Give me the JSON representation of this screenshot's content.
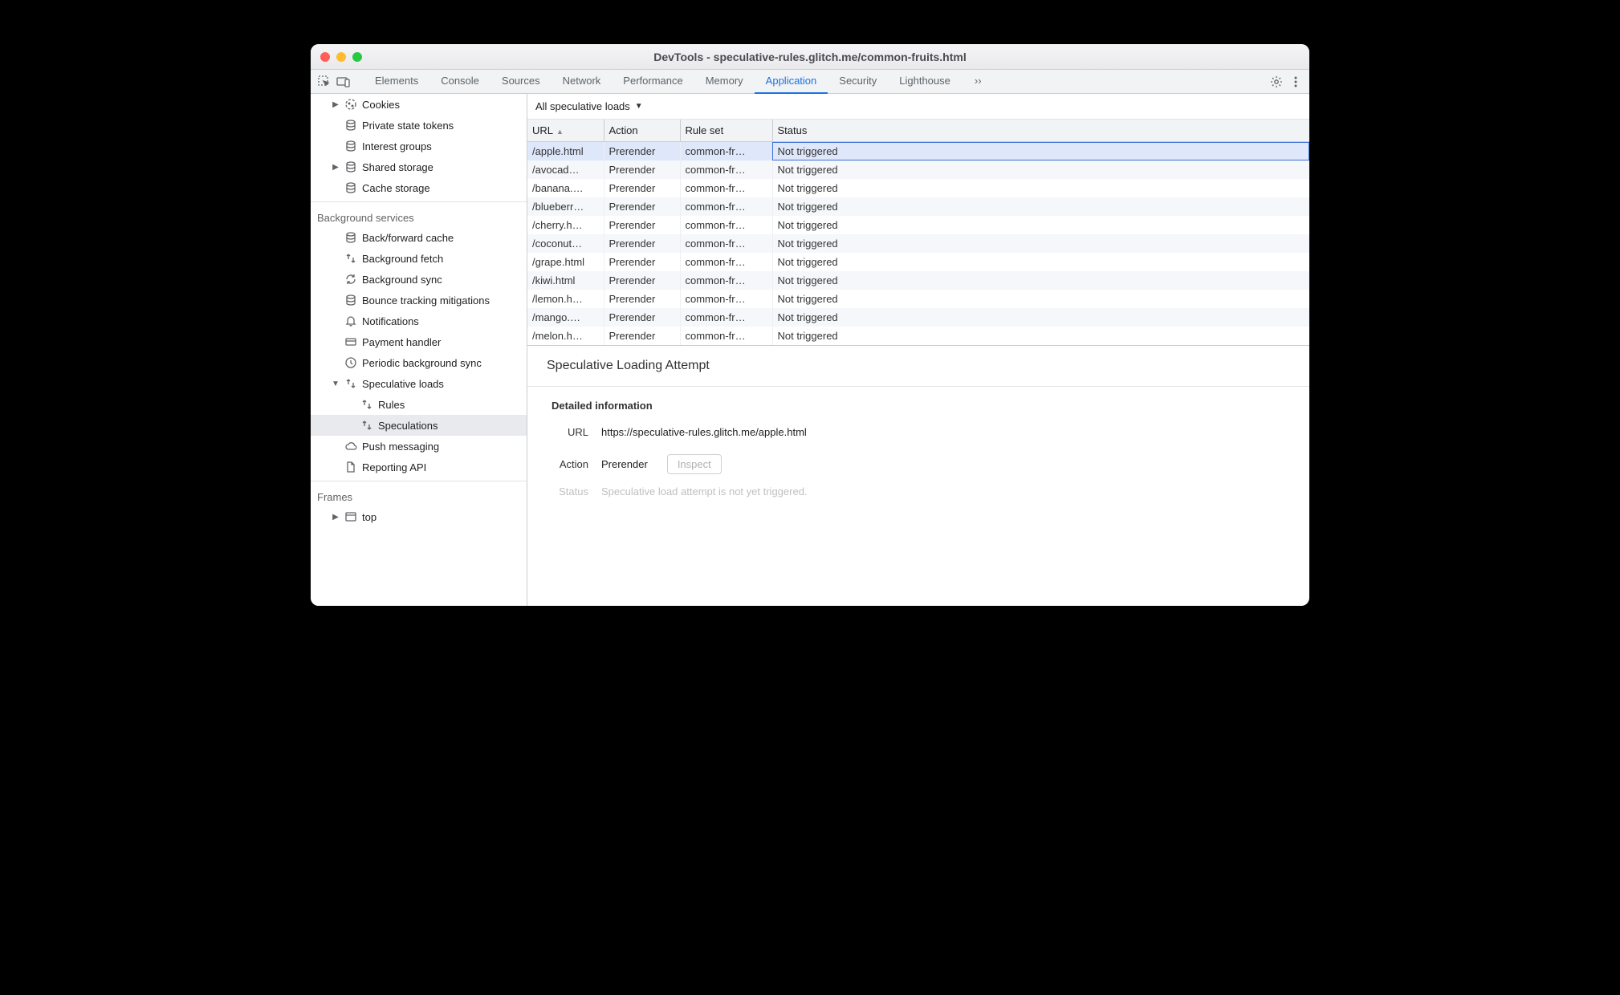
{
  "window": {
    "title": "DevTools - speculative-rules.glitch.me/common-fruits.html"
  },
  "tabs": {
    "items": [
      "Elements",
      "Console",
      "Sources",
      "Network",
      "Performance",
      "Memory",
      "Application",
      "Security",
      "Lighthouse"
    ],
    "active": "Application",
    "overflow_glyph": "››"
  },
  "sidebar": {
    "storage": [
      {
        "icon": "broken-cookie-icon",
        "label": "Cookies",
        "caret": true
      },
      {
        "icon": "db-icon",
        "label": "Private state tokens"
      },
      {
        "icon": "db-icon",
        "label": "Interest groups"
      },
      {
        "icon": "db-icon",
        "label": "Shared storage",
        "caret": true
      },
      {
        "icon": "db-icon",
        "label": "Cache storage"
      }
    ],
    "bg_title": "Background services",
    "bg": [
      {
        "icon": "db-icon",
        "label": "Back/forward cache"
      },
      {
        "icon": "updown-icon",
        "label": "Background fetch"
      },
      {
        "icon": "sync-icon",
        "label": "Background sync"
      },
      {
        "icon": "db-icon",
        "label": "Bounce tracking mitigations"
      },
      {
        "icon": "bell-icon",
        "label": "Notifications"
      },
      {
        "icon": "card-icon",
        "label": "Payment handler"
      },
      {
        "icon": "clock-icon",
        "label": "Periodic background sync"
      },
      {
        "icon": "updown-icon",
        "label": "Speculative loads",
        "caret": true,
        "expanded": true,
        "children": [
          {
            "icon": "updown-icon",
            "label": "Rules"
          },
          {
            "icon": "updown-icon",
            "label": "Speculations",
            "selected": true
          }
        ]
      },
      {
        "icon": "cloud-icon",
        "label": "Push messaging"
      },
      {
        "icon": "doc-icon",
        "label": "Reporting API"
      }
    ],
    "frames_title": "Frames",
    "frames": [
      {
        "icon": "frame-icon",
        "label": "top",
        "caret": true
      }
    ]
  },
  "filter": {
    "label": "All speculative loads"
  },
  "table": {
    "columns": [
      "URL",
      "Action",
      "Rule set",
      "Status"
    ],
    "sort_col": 0,
    "rows": [
      {
        "url": "/apple.html",
        "action": "Prerender",
        "ruleset": "common-fr…",
        "status": "Not triggered",
        "selected": true
      },
      {
        "url": "/avocad…",
        "action": "Prerender",
        "ruleset": "common-fr…",
        "status": "Not triggered"
      },
      {
        "url": "/banana.…",
        "action": "Prerender",
        "ruleset": "common-fr…",
        "status": "Not triggered"
      },
      {
        "url": "/blueberr…",
        "action": "Prerender",
        "ruleset": "common-fr…",
        "status": "Not triggered"
      },
      {
        "url": "/cherry.h…",
        "action": "Prerender",
        "ruleset": "common-fr…",
        "status": "Not triggered"
      },
      {
        "url": "/coconut…",
        "action": "Prerender",
        "ruleset": "common-fr…",
        "status": "Not triggered"
      },
      {
        "url": "/grape.html",
        "action": "Prerender",
        "ruleset": "common-fr…",
        "status": "Not triggered"
      },
      {
        "url": "/kiwi.html",
        "action": "Prerender",
        "ruleset": "common-fr…",
        "status": "Not triggered"
      },
      {
        "url": "/lemon.h…",
        "action": "Prerender",
        "ruleset": "common-fr…",
        "status": "Not triggered"
      },
      {
        "url": "/mango.…",
        "action": "Prerender",
        "ruleset": "common-fr…",
        "status": "Not triggered"
      },
      {
        "url": "/melon.h…",
        "action": "Prerender",
        "ruleset": "common-fr…",
        "status": "Not triggered"
      }
    ]
  },
  "detail": {
    "heading": "Speculative Loading Attempt",
    "section": "Detailed information",
    "url_label": "URL",
    "url_value": "https://speculative-rules.glitch.me/apple.html",
    "action_label": "Action",
    "action_value": "Prerender",
    "inspect_label": "Inspect",
    "status_label": "Status",
    "status_value": "Speculative load attempt is not yet triggered."
  }
}
